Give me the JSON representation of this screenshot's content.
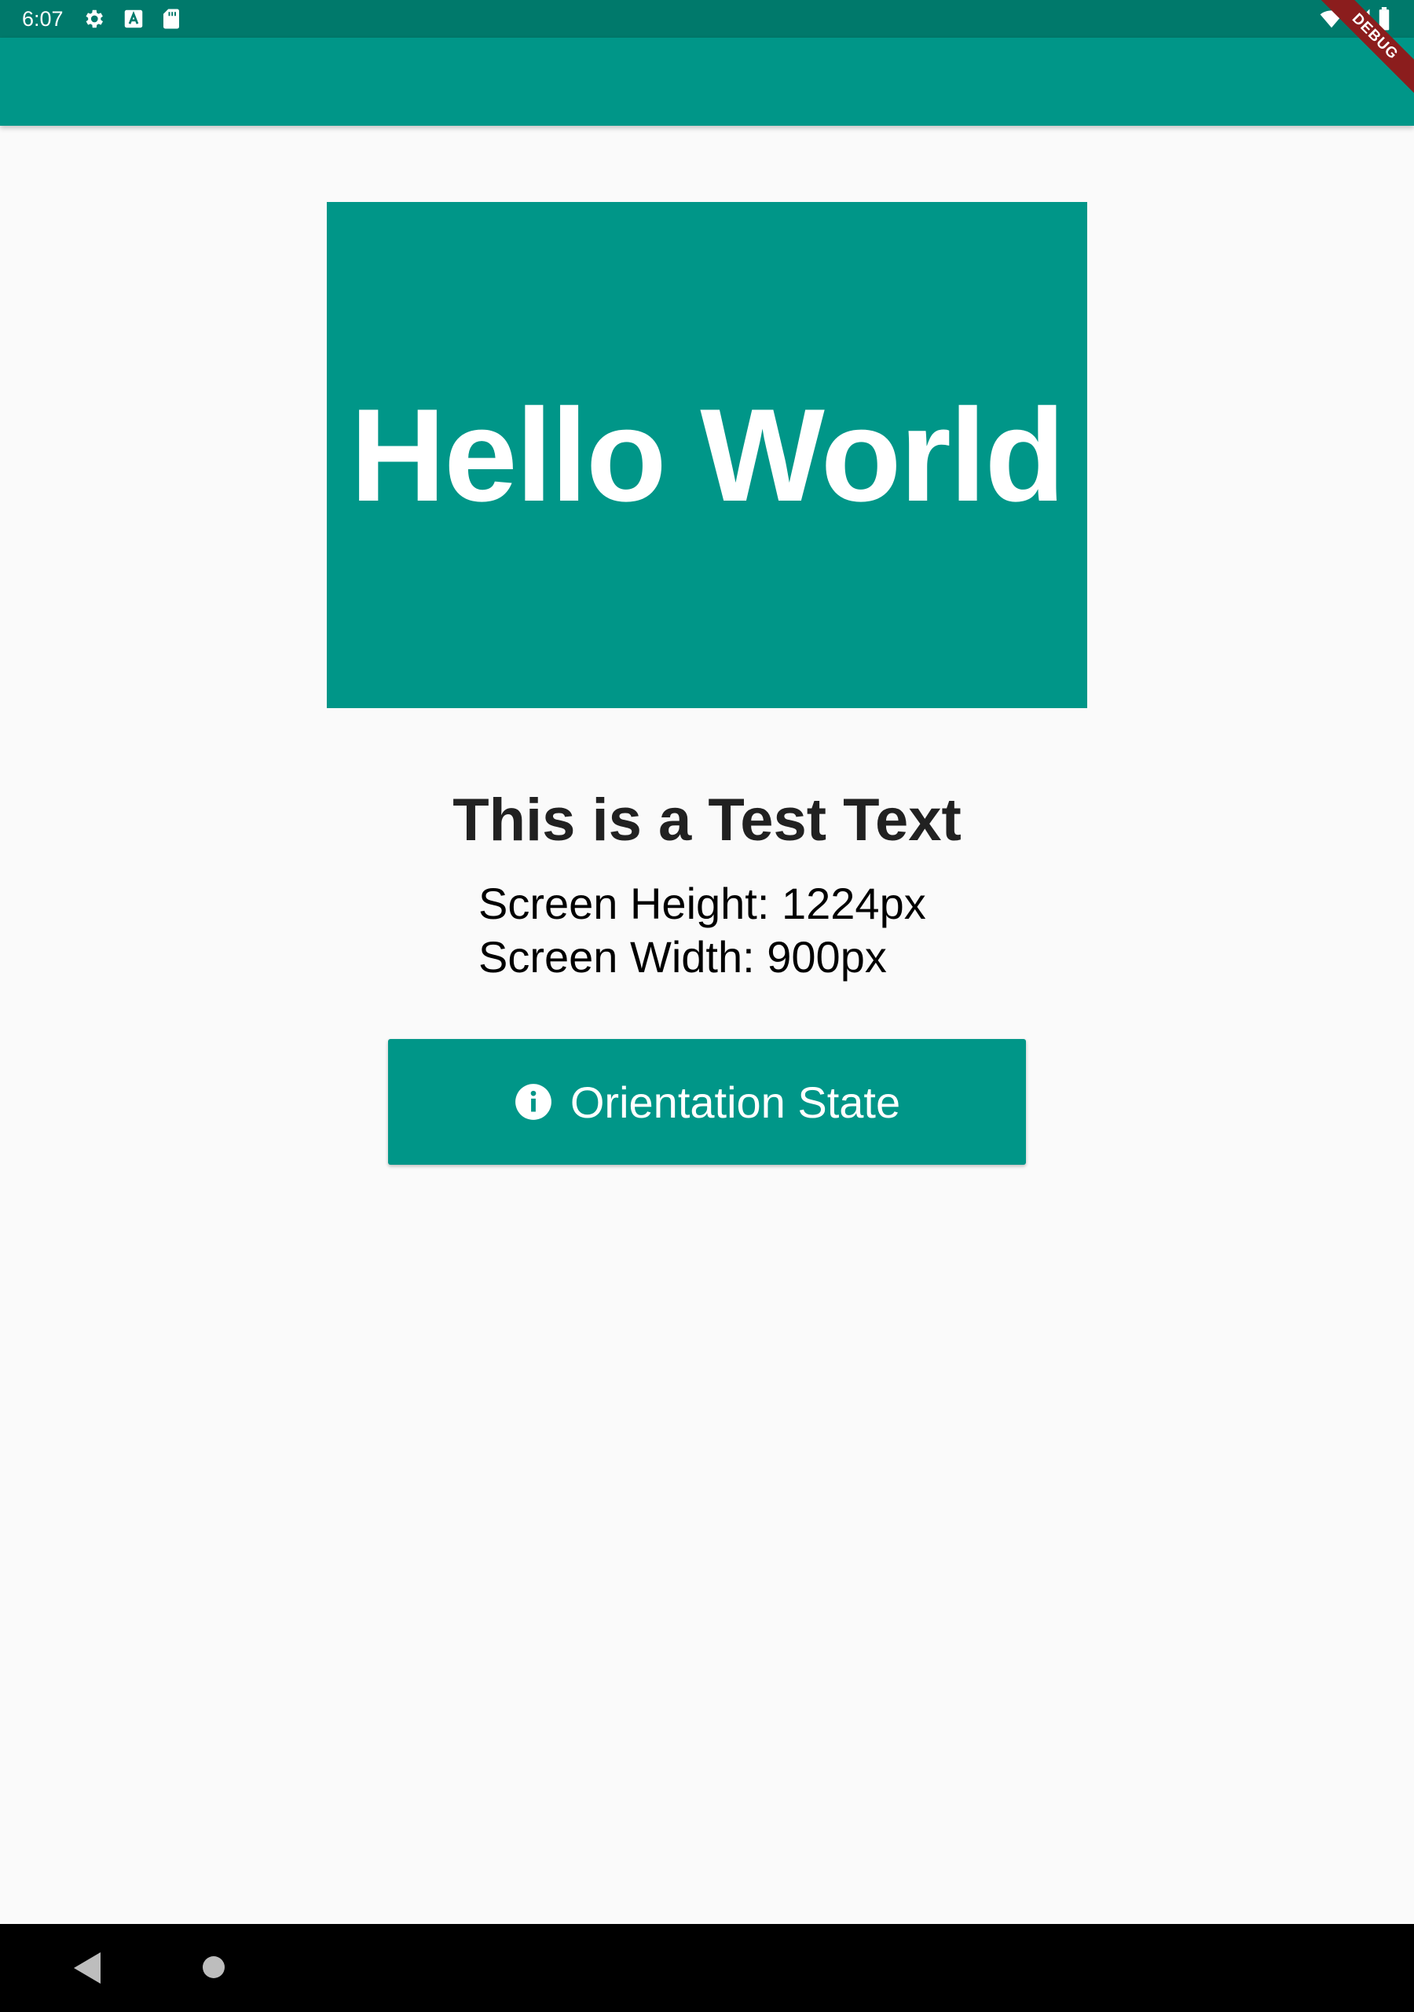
{
  "status_bar": {
    "time": "6:07",
    "left_icons": [
      "gear-icon",
      "a-box-icon",
      "sd-card-icon"
    ],
    "right_icons": [
      "wifi-icon",
      "cellular-signal-icon",
      "battery-icon"
    ]
  },
  "debug_banner": {
    "label": "DEBUG"
  },
  "hello_box": {
    "text": "Hello World"
  },
  "test_title": "This is a Test Text",
  "screen_info": {
    "height_line": "Screen Height: 1224px",
    "width_line": "Screen Width: 900px"
  },
  "orientation_button": {
    "icon": "info-icon",
    "label": "Orientation State"
  },
  "nav_bar": {
    "icons": [
      "back-icon",
      "home-icon"
    ]
  },
  "colors": {
    "primary": "#009688",
    "primary_dark": "#00796b",
    "background": "#fafafa",
    "debug": "#8b1d1d"
  }
}
